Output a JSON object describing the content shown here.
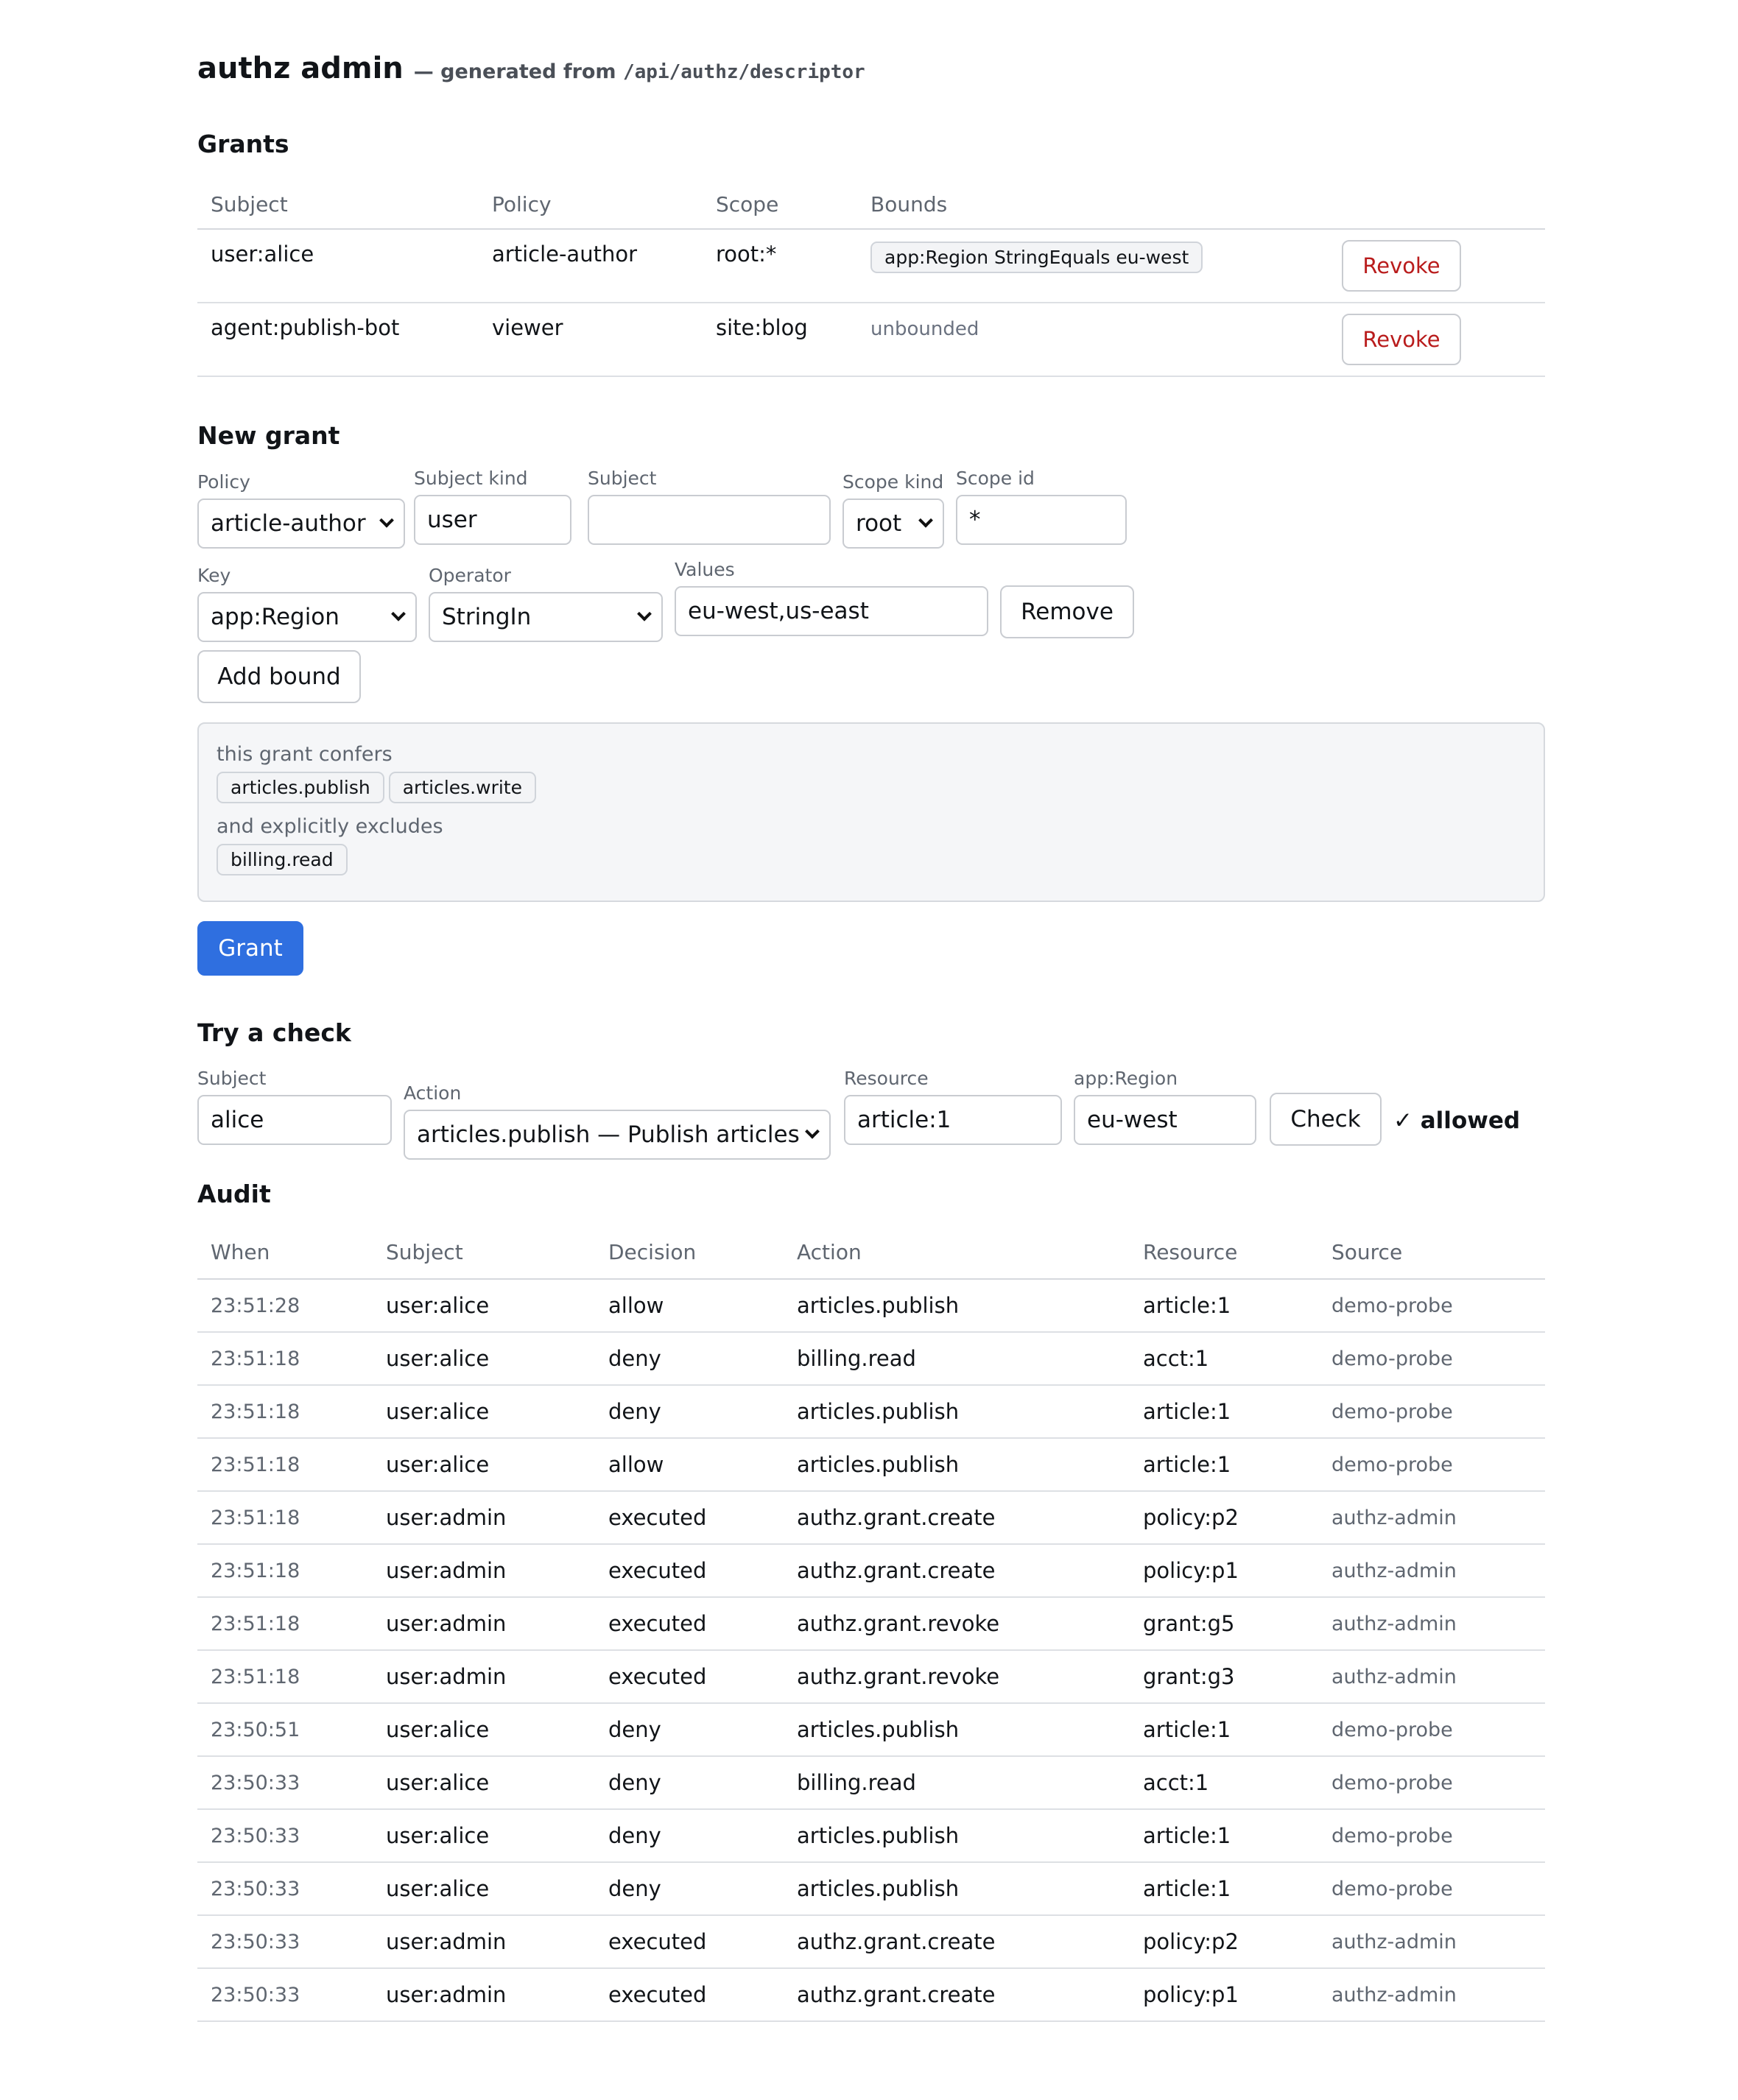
{
  "header": {
    "title": "authz admin",
    "subtitle_prefix": "— generated from",
    "subtitle_path": "/api/authz/descriptor"
  },
  "grants": {
    "heading": "Grants",
    "columns": [
      "Subject",
      "Policy",
      "Scope",
      "Bounds"
    ],
    "revoke_label": "Revoke",
    "rows": [
      {
        "subject": "user:alice",
        "policy": "article-author",
        "scope": "root:*",
        "bounds": "app:Region StringEquals eu-west",
        "bounded": true
      },
      {
        "subject": "agent:publish-bot",
        "policy": "viewer",
        "scope": "site:blog",
        "bounds": "unbounded",
        "bounded": false
      }
    ]
  },
  "new_grant": {
    "heading": "New grant",
    "policy": {
      "label": "Policy",
      "value": "article-author"
    },
    "subject_kind": {
      "label": "Subject kind",
      "value": "user"
    },
    "subject": {
      "label": "Subject",
      "value": ""
    },
    "scope_kind": {
      "label": "Scope kind",
      "value": "root"
    },
    "scope_id": {
      "label": "Scope id",
      "value": "*"
    },
    "bound": {
      "key_label": "Key",
      "key_value": "app:Region",
      "operator_label": "Operator",
      "operator_value": "StringIn",
      "values_label": "Values",
      "values_value": "eu-west,us-east",
      "remove_label": "Remove"
    },
    "add_bound_label": "Add bound",
    "confers_label": "this grant confers",
    "confers": [
      "articles.publish",
      "articles.write"
    ],
    "excludes_label": "and explicitly excludes",
    "excludes": [
      "billing.read"
    ],
    "grant_label": "Grant"
  },
  "check": {
    "heading": "Try a check",
    "subject": {
      "label": "Subject",
      "value": "alice"
    },
    "action": {
      "label": "Action",
      "value": "articles.publish — Publish articles"
    },
    "resource": {
      "label": "Resource",
      "value": "article:1"
    },
    "region": {
      "label": "app:Region",
      "value": "eu-west"
    },
    "check_label": "Check",
    "result": "✓ allowed"
  },
  "audit": {
    "heading": "Audit",
    "columns": [
      "When",
      "Subject",
      "Decision",
      "Action",
      "Resource",
      "Source"
    ],
    "rows": [
      {
        "when": "23:51:28",
        "subject": "user:alice",
        "decision": "allow",
        "action": "articles.publish",
        "resource": "article:1",
        "source": "demo-probe"
      },
      {
        "when": "23:51:18",
        "subject": "user:alice",
        "decision": "deny",
        "action": "billing.read",
        "resource": "acct:1",
        "source": "demo-probe"
      },
      {
        "when": "23:51:18",
        "subject": "user:alice",
        "decision": "deny",
        "action": "articles.publish",
        "resource": "article:1",
        "source": "demo-probe"
      },
      {
        "when": "23:51:18",
        "subject": "user:alice",
        "decision": "allow",
        "action": "articles.publish",
        "resource": "article:1",
        "source": "demo-probe"
      },
      {
        "when": "23:51:18",
        "subject": "user:admin",
        "decision": "executed",
        "action": "authz.grant.create",
        "resource": "policy:p2",
        "source": "authz-admin"
      },
      {
        "when": "23:51:18",
        "subject": "user:admin",
        "decision": "executed",
        "action": "authz.grant.create",
        "resource": "policy:p1",
        "source": "authz-admin"
      },
      {
        "when": "23:51:18",
        "subject": "user:admin",
        "decision": "executed",
        "action": "authz.grant.revoke",
        "resource": "grant:g5",
        "source": "authz-admin"
      },
      {
        "when": "23:51:18",
        "subject": "user:admin",
        "decision": "executed",
        "action": "authz.grant.revoke",
        "resource": "grant:g3",
        "source": "authz-admin"
      },
      {
        "when": "23:50:51",
        "subject": "user:alice",
        "decision": "deny",
        "action": "articles.publish",
        "resource": "article:1",
        "source": "demo-probe"
      },
      {
        "when": "23:50:33",
        "subject": "user:alice",
        "decision": "deny",
        "action": "billing.read",
        "resource": "acct:1",
        "source": "demo-probe"
      },
      {
        "when": "23:50:33",
        "subject": "user:alice",
        "decision": "deny",
        "action": "articles.publish",
        "resource": "article:1",
        "source": "demo-probe"
      },
      {
        "when": "23:50:33",
        "subject": "user:alice",
        "decision": "deny",
        "action": "articles.publish",
        "resource": "article:1",
        "source": "demo-probe"
      },
      {
        "when": "23:50:33",
        "subject": "user:admin",
        "decision": "executed",
        "action": "authz.grant.create",
        "resource": "policy:p2",
        "source": "authz-admin"
      },
      {
        "when": "23:50:33",
        "subject": "user:admin",
        "decision": "executed",
        "action": "authz.grant.create",
        "resource": "policy:p1",
        "source": "authz-admin"
      }
    ]
  }
}
